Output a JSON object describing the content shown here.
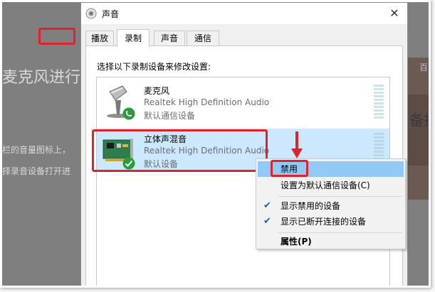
{
  "background_page": {
    "heading_fragment": "麦克风进行",
    "line1_fragment": "栏的音量图标上，",
    "line2_fragment": "择录音设备打开进",
    "right_char_top": "百",
    "right_text": "备打"
  },
  "window": {
    "title": "声音",
    "close_glyph": "✕"
  },
  "tabs": [
    {
      "label": "播放",
      "active": false
    },
    {
      "label": "录制",
      "active": true
    },
    {
      "label": "声音",
      "active": false
    },
    {
      "label": "通信",
      "active": false
    }
  ],
  "instruction": "选择以下录制设备来修改设置:",
  "devices": [
    {
      "name": "麦克风",
      "driver": "Realtek High Definition Audio",
      "status": "默认通信设备",
      "icon": "microphone-icon",
      "badge": "phone-badge-icon",
      "selected": false
    },
    {
      "name": "立体声混音",
      "driver": "Realtek High Definition Audio",
      "status": "默认设备",
      "icon": "sound-card-icon",
      "badge": "check-badge-icon",
      "selected": true
    }
  ],
  "context_menu": {
    "items": [
      {
        "label": "禁用",
        "checked": false,
        "bold": false,
        "highlighted": true
      },
      {
        "label": "设置为默认通信设备(C)",
        "checked": false,
        "bold": false,
        "highlighted": false
      },
      {
        "label": "显示禁用的设备",
        "checked": true,
        "bold": false,
        "highlighted": false
      },
      {
        "label": "显示已断开连接的设备",
        "checked": true,
        "bold": false,
        "highlighted": false
      },
      {
        "label": "属性(P)",
        "checked": false,
        "bold": true,
        "highlighted": false
      }
    ],
    "check_glyph": "✔"
  },
  "colors": {
    "annotation_red": "#e0222c",
    "selection_blue": "#cce8ff",
    "menu_highlight": "#91c9f7",
    "check_blue": "#1e5ea8"
  }
}
